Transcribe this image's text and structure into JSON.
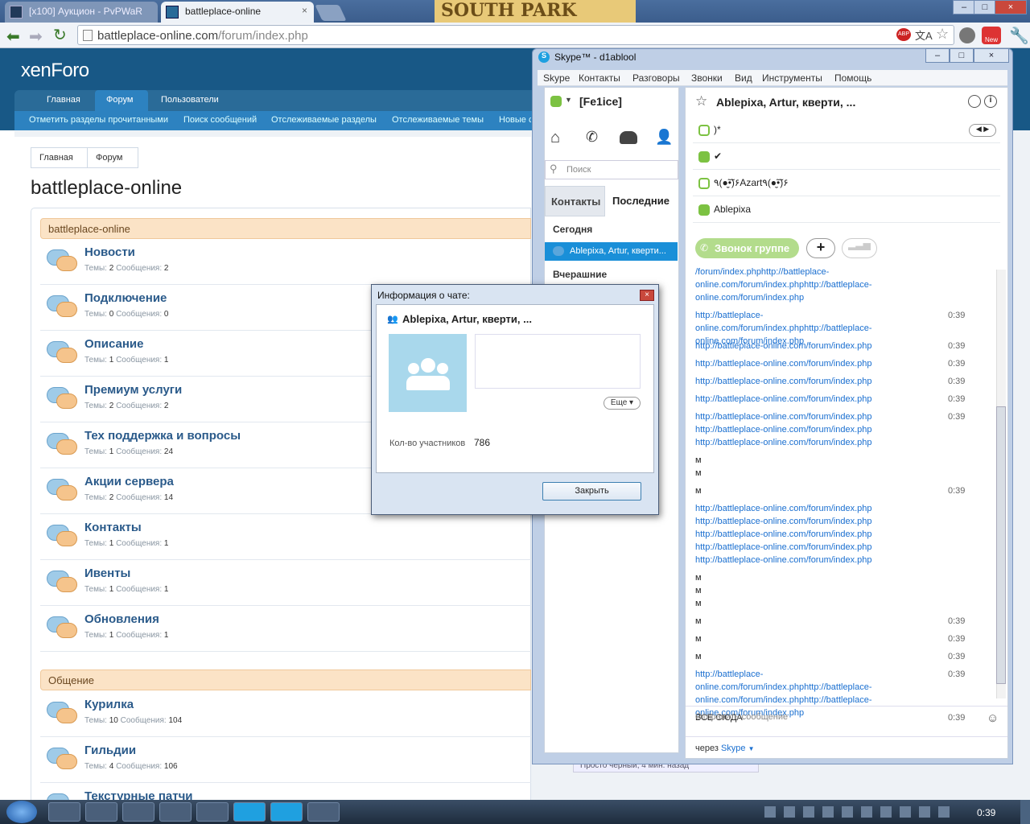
{
  "browser": {
    "tabs": [
      {
        "title": "[x100] Аукцион - PvPWaR"
      },
      {
        "title": "battleplace-online"
      }
    ],
    "address_host": "battleplace-online.com",
    "address_path": "/forum/index.php",
    "banner_text": "SOUTH PARK",
    "translate_glyph": "文A",
    "abp_badge": "ABP",
    "new_badge": "New"
  },
  "forum": {
    "logo": "xenForo",
    "nav_tabs": [
      "Главная",
      "Форум",
      "Пользователи"
    ],
    "active_tab": "Форум",
    "sub_links": [
      "Отметить разделы прочитанными",
      "Поиск сообщений",
      "Отслеживаемые разделы",
      "Отслеживаемые темы",
      "Новые с"
    ],
    "breadcrumbs": [
      "Главная",
      "Форум"
    ],
    "page_title": "battleplace-online",
    "categories": [
      {
        "title": "battleplace-online",
        "nodes": [
          {
            "name": "Новости",
            "threads": "2",
            "posts": "2"
          },
          {
            "name": "Подключение",
            "threads": "0",
            "posts": "0"
          },
          {
            "name": "Описание",
            "threads": "1",
            "posts": "1"
          },
          {
            "name": "Премиум услуги",
            "threads": "2",
            "posts": "2"
          },
          {
            "name": "Тех поддержка и вопросы",
            "threads": "1",
            "posts": "24"
          },
          {
            "name": "Акции сервера",
            "threads": "2",
            "posts": "14"
          },
          {
            "name": "Контакты",
            "threads": "1",
            "posts": "1"
          },
          {
            "name": "Ивенты",
            "threads": "1",
            "posts": "1"
          },
          {
            "name": "Обновления",
            "threads": "1",
            "posts": "1"
          }
        ]
      },
      {
        "title": "Общение",
        "nodes": [
          {
            "name": "Курилка",
            "threads": "10",
            "posts": "104"
          },
          {
            "name": "Гильдии",
            "threads": "4",
            "posts": "106"
          },
          {
            "name": "Текстурные патчи",
            "threads": "",
            "posts": ""
          }
        ]
      }
    ],
    "threads_label": "Темы:",
    "posts_label": "Сообщения:",
    "last_post_snippet": "Просто черный, 4 мин. назад"
  },
  "skype": {
    "title": "Skype™ - d1ablool",
    "menu": [
      "Skype",
      "Контакты",
      "Разговоры",
      "Звонки",
      "Вид",
      "Инструменты",
      "Помощь"
    ],
    "user": "[Fe1ice]",
    "search_placeholder": "Поиск",
    "tabs": [
      "Контакты",
      "Последние"
    ],
    "today_label": "Сегодня",
    "selected_chat": "Ablepixa, Artur, кверти...",
    "yesterday_label": "Вчерашние",
    "chat_title": "Ablepixa, Artur, кверти, ...",
    "members": [
      {
        "name": ")*",
        "status": "away"
      },
      {
        "name": "✔",
        "status": "online"
      },
      {
        "name": "٩(●̮̮̃•̃)۶Azart٩(●̮̮̃•̃)۶",
        "status": "away"
      },
      {
        "name": "Ablepixa",
        "status": "online"
      }
    ],
    "call_group_label": "Звонок группе",
    "messages": [
      {
        "text": "/forum/index.phphttp://battleplace-online.com/forum/index.phphttp://battleplace-online.com/forum/index.php",
        "time": "",
        "link": true
      },
      {
        "text": "http://battleplace-online.com/forum/index.phphttp://battleplace-online.com/forum/index.php",
        "time": "0:39",
        "link": true
      },
      {
        "text": "http://battleplace-online.com/forum/index.php",
        "time": "0:39",
        "link": true
      },
      {
        "text": "http://battleplace-online.com/forum/index.php",
        "time": "0:39",
        "link": true
      },
      {
        "text": "http://battleplace-online.com/forum/index.php",
        "time": "0:39",
        "link": true
      },
      {
        "text": "http://battleplace-online.com/forum/index.php",
        "time": "0:39",
        "link": true
      },
      {
        "text": "http://battleplace-online.com/forum/index.php\nhttp://battleplace-online.com/forum/index.php\nhttp://battleplace-online.com/forum/index.php",
        "time": "0:39",
        "link": true
      },
      {
        "text": "м\nм",
        "time": "",
        "link": false
      },
      {
        "text": "м",
        "time": "0:39",
        "link": false
      },
      {
        "text": "http://battleplace-online.com/forum/index.php\nhttp://battleplace-online.com/forum/index.php\nhttp://battleplace-online.com/forum/index.php\nhttp://battleplace-online.com/forum/index.php\nhttp://battleplace-online.com/forum/index.php",
        "time": "",
        "link": true
      },
      {
        "text": "м\nм\nм",
        "time": "",
        "link": false
      },
      {
        "text": "м",
        "time": "0:39",
        "link": false
      },
      {
        "text": "м",
        "time": "0:39",
        "link": false
      },
      {
        "text": "м",
        "time": "0:39",
        "link": false
      },
      {
        "text": "http://battleplace-online.com/forum/index.phphttp://battleplace-online.com/forum/index.phphttp://battleplace-online.com/forum/index.php",
        "time": "0:39",
        "link": true
      },
      {
        "text": "ВСЕ СЮДА",
        "time": "0:39",
        "link": false
      }
    ],
    "input_placeholder": "Отправить сообщение",
    "via_label": "через",
    "via_link": "Skype"
  },
  "dialog": {
    "title": "Информация о чате:",
    "chat_name": "Ablepixa, Artur, кверти, ...",
    "more_label": "Еще",
    "participants_label": "Кол-во участников",
    "participants_count": "786",
    "close_label": "Закрыть"
  },
  "taskbar": {
    "clock": "0:39"
  },
  "colors": {
    "forum_header": "#185886",
    "accent_blue": "#1a6fd0",
    "skype_green": "#7cc242",
    "category_bar": "#fbe3c6"
  }
}
